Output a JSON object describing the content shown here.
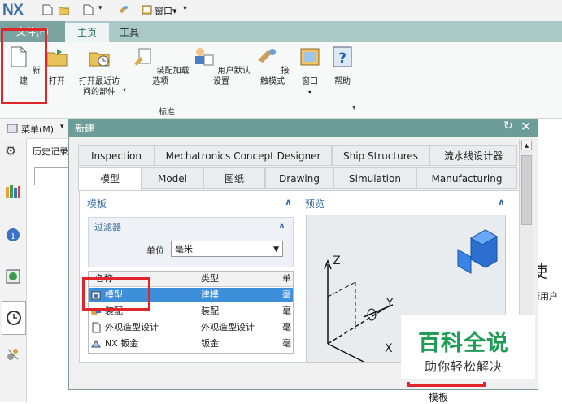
{
  "titlebar": {
    "logo": "NX",
    "window_menu_label": "窗口",
    "window_menu_arrow": "▾",
    "customize_arrow": "▾"
  },
  "tabs": {
    "file": "文件(F)",
    "home": "主页",
    "tools": "工具"
  },
  "ribbon": {
    "buttons": [
      {
        "label": "新建",
        "icon": "new-file-icon"
      },
      {
        "label": "打开",
        "icon": "open-folder-icon"
      },
      {
        "label": "打开最近访问的部件",
        "line1": "打开最近访",
        "line2": "问的部件",
        "icon": "recent-parts-icon"
      },
      {
        "label": "装配加载选项",
        "icon": "assembly-load-options-icon"
      },
      {
        "label": "用户默认设置",
        "icon": "user-defaults-icon"
      },
      {
        "label": "接触模式",
        "icon": "touch-mode-icon"
      },
      {
        "label": "窗口",
        "icon": "window-icon"
      },
      {
        "label": "帮助",
        "icon": "help-icon"
      }
    ],
    "group_label": "标准"
  },
  "menubar": {
    "label": "菜单(M)",
    "arrow": "▾"
  },
  "left_panel": {
    "history_label": "历史记录"
  },
  "background_text": {
    "right_big": "使",
    "right_small": "新用户",
    "bottom": "模板"
  },
  "dialog": {
    "title": "新建",
    "tabs_row1": [
      "Inspection",
      "Mechatronics Concept Designer",
      "Ship Structures",
      "流水线设计器"
    ],
    "tabs_row2": [
      "模型",
      "Model",
      "图纸",
      "Drawing",
      "Simulation",
      "Manufacturing"
    ],
    "selected_tab": "模型",
    "template_section": "模板",
    "preview_section": "预览",
    "filter_title": "过滤器",
    "unit_label": "单位",
    "unit_value": "毫米",
    "list_headers": [
      "名称",
      "类型",
      "单"
    ],
    "rows": [
      {
        "name": "模型",
        "type": "建模",
        "unit": "毫"
      },
      {
        "name": "装配",
        "type": "装配",
        "unit": "毫"
      },
      {
        "name": "外观造型设计",
        "type": "外观造型设计",
        "unit": "毫"
      },
      {
        "name": "NX 钣金",
        "type": "钣金",
        "unit": "毫"
      }
    ],
    "axis_z": "Z",
    "axis_y": "Y",
    "axis_x": "X"
  },
  "watermark": {
    "title": "百科全说",
    "subtitle": "助你轻松解决"
  },
  "colors": {
    "accent": "#6d9d98",
    "selection": "#3c8fd8",
    "highlight_box": "#e0262c",
    "watermark_green": "#1f9d55"
  }
}
